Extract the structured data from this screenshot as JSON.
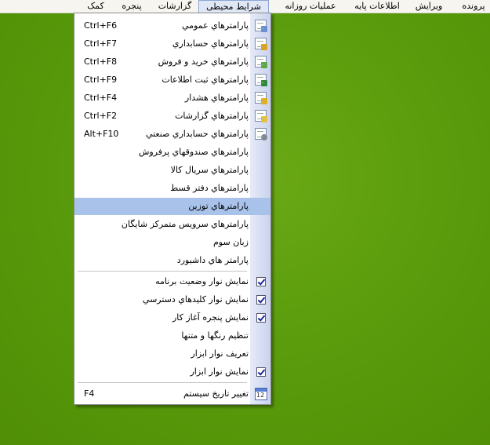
{
  "menubar": {
    "items": [
      {
        "label": "پرونده"
      },
      {
        "label": "ویرایش"
      },
      {
        "label": "اطلاعات پایه"
      },
      {
        "label": "عملیات روزانه"
      },
      {
        "label": "شرایط محیطی"
      },
      {
        "label": "گزارشات"
      },
      {
        "label": "پنجره"
      },
      {
        "label": "کمک"
      }
    ]
  },
  "dropdown": {
    "items": [
      {
        "label": "پارامترهاي عمومي",
        "shortcut": "Ctrl+F6",
        "icon": "document-settings-icon"
      },
      {
        "label": "پارامترهاي حسابداري",
        "shortcut": "Ctrl+F7",
        "icon": "document-accounting-icon"
      },
      {
        "label": "پارامترهاي خريد و فروش",
        "shortcut": "Ctrl+F8",
        "icon": "document-sales-icon"
      },
      {
        "label": "پارامترهاي ثبت اطلاعات",
        "shortcut": "Ctrl+F9",
        "icon": "document-data-entry-icon"
      },
      {
        "label": "پارامترهاي هشدار",
        "shortcut": "Ctrl+F4",
        "icon": "document-warning-icon"
      },
      {
        "label": "پارامترهاي گزارشات",
        "shortcut": "Ctrl+F2",
        "icon": "document-reports-icon"
      },
      {
        "label": "پارامترهاي حسابداري صنعتي",
        "shortcut": "Alt+F10",
        "icon": "document-gear-icon"
      },
      {
        "label": "پارامترهاي صندوقهاي پرفروش",
        "shortcut": ""
      },
      {
        "label": "پارامترهاي سريال کالا",
        "shortcut": ""
      },
      {
        "label": "پارامترهاي دفتر قسط",
        "shortcut": ""
      },
      {
        "label": "پارامترهاي توزين",
        "shortcut": ""
      },
      {
        "label": "پارامترهاي سرويس متمرکز شايگان",
        "shortcut": ""
      },
      {
        "label": "زبان سوم",
        "shortcut": ""
      },
      {
        "label": "پارامتر هاي داشبورد",
        "shortcut": ""
      },
      {
        "label": "نمايش نوار وضعيت برنامه",
        "checked": true
      },
      {
        "label": "نمايش نوار کليدهاي دسترسي",
        "checked": true
      },
      {
        "label": "نمايش پنجره آغاز کار",
        "checked": true
      },
      {
        "label": "تنظيم رنگها و متنها"
      },
      {
        "label": "تعريف نوار ابزار"
      },
      {
        "label": "نمايش نوار ابزار",
        "checked": true
      },
      {
        "label": "تغيير تاريخ سيستم",
        "shortcut": "F4",
        "icon": "calendar-icon",
        "icon_text": "12"
      }
    ]
  },
  "colors": {
    "desktop": "#5a9c0c",
    "highlight": "#a8c2ea",
    "stripe": "#c9d3ee"
  }
}
